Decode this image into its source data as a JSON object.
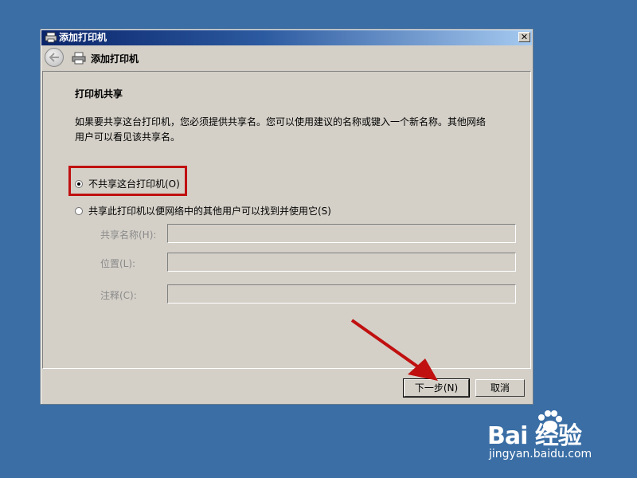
{
  "window": {
    "title": "添加打印机",
    "close_label": "✕"
  },
  "nav": {
    "title": "添加打印机"
  },
  "content": {
    "heading": "打印机共享",
    "description": "如果要共享这台打印机，您必须提供共享名。您可以使用建议的名称或键入一个新名称。其他网络用户可以看见该共享名。",
    "option_no_share": "不共享这台打印机(O)",
    "option_share": "共享此打印机以便网络中的其他用户可以找到并使用它(S)",
    "fields": {
      "share_name_label": "共享名称(H):",
      "share_name_value": "",
      "location_label": "位置(L):",
      "location_value": "",
      "comment_label": "注释(C):",
      "comment_value": ""
    }
  },
  "footer": {
    "next_label": "下一步(N)",
    "cancel_label": "取消"
  },
  "watermark": {
    "logo": "Bai  经验",
    "url": "jingyan.baidu.com"
  },
  "colors": {
    "desktop": "#3a6ea5",
    "dialog": "#d4d0c8",
    "highlight": "#c01010"
  }
}
